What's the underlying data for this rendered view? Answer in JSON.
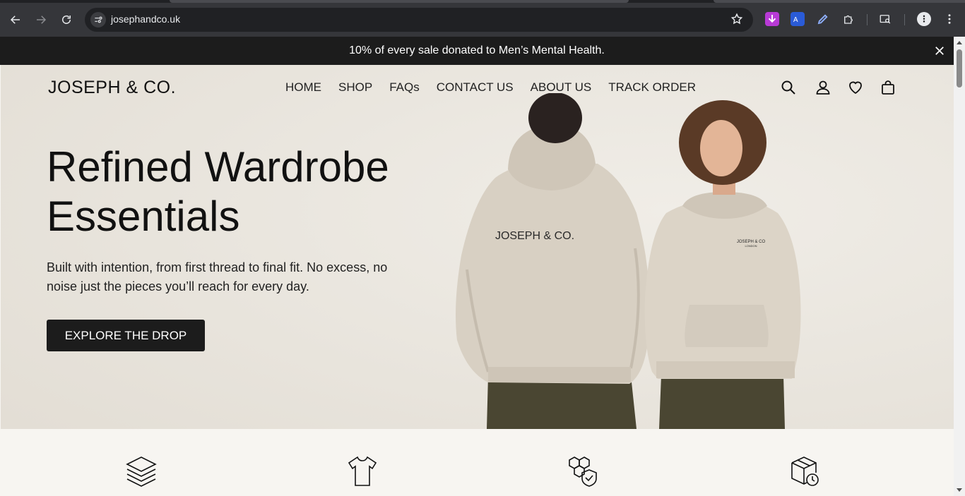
{
  "browser": {
    "url": "josephandco.uk",
    "icons": [
      "back-icon",
      "forward-icon",
      "reload-icon",
      "site-info-icon",
      "bookmark-star-icon",
      "extension-download-icon",
      "extension-translate-icon",
      "extension-pen-icon",
      "extensions-puzzle-icon",
      "tab-search-icon",
      "profile-icon",
      "menu-icon"
    ]
  },
  "announcement": {
    "text": "10% of every sale donated to Men’s Mental Health."
  },
  "header": {
    "logo": "JOSEPH & CO.",
    "nav": [
      "HOME",
      "SHOP",
      "FAQs",
      "CONTACT US",
      "ABOUT US",
      "TRACK ORDER"
    ],
    "icons": [
      "search-icon",
      "account-icon",
      "wishlist-heart-icon",
      "cart-bag-icon"
    ]
  },
  "hero": {
    "headline_line1": "Refined Wardrobe",
    "headline_line2": "Essentials",
    "subtext": "Built with intention, from first thread to final fit. No excess, no noise just the pieces you’ll reach for every day.",
    "cta": "EXPLORE THE DROP",
    "hoodie_back_print": "JOSEPH & CO.",
    "hoodie_front_print": "JOSEPH & CO",
    "hoodie_front_print_sub": "LONDON"
  },
  "features": {
    "icons": [
      "layers-icon",
      "tshirt-icon",
      "quality-shield-icon",
      "delivery-box-icon"
    ]
  },
  "colors": {
    "announcement_bg": "#1c1c1c",
    "hero_bg": "#eae6df",
    "cta_bg": "#1c1c1c",
    "hoodie": "#d8d0c3",
    "trousers": "#4a4632"
  }
}
